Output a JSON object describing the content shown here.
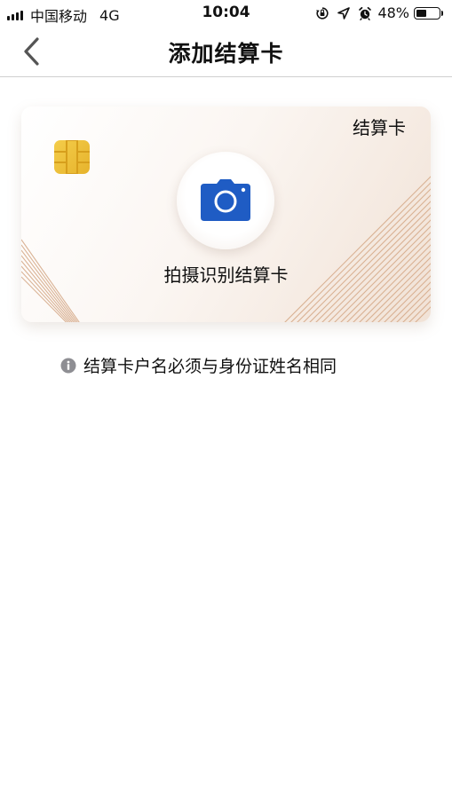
{
  "status_bar": {
    "carrier": "中国移动",
    "network": "4G",
    "time": "10:04",
    "battery_percent": "48%",
    "battery_level": 0.48,
    "icons": [
      "orientation-lock-icon",
      "location-icon",
      "alarm-icon",
      "battery-icon"
    ]
  },
  "navbar": {
    "back_icon": "chevron-left-icon",
    "title": "添加结算卡"
  },
  "card": {
    "label": "结算卡",
    "action_label": "拍摄识别结算卡",
    "camera_icon": "camera-icon",
    "chip_icon": "chip-icon",
    "camera_color": "#1f5cc4"
  },
  "notice": {
    "icon": "info-icon",
    "text": "结算卡户名必须与身份证姓名相同"
  }
}
